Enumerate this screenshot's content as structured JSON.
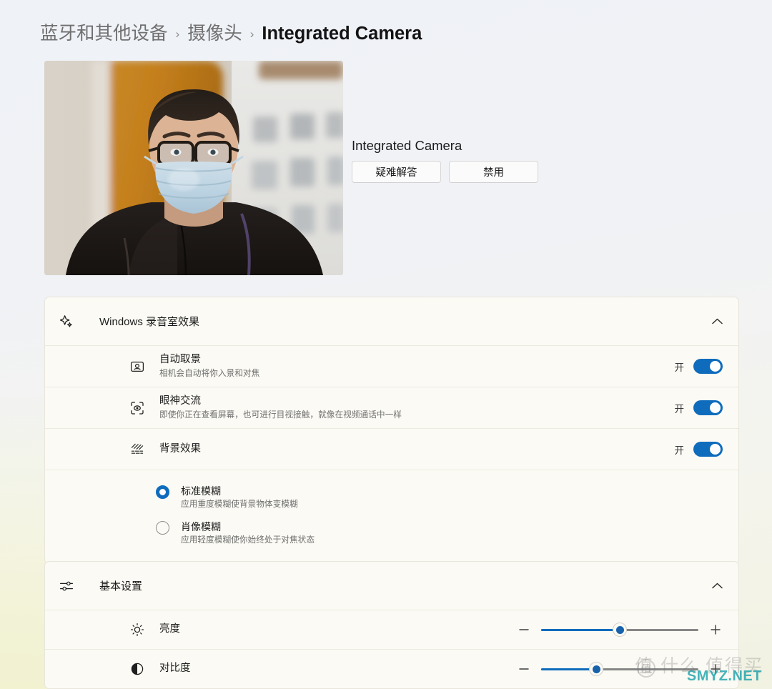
{
  "breadcrumb": {
    "items": [
      {
        "label": "蓝牙和其他设备",
        "current": false
      },
      {
        "label": "摄像头",
        "current": false
      },
      {
        "label": "Integrated Camera",
        "current": true
      }
    ],
    "separator": "›"
  },
  "preview": {
    "alt_name": "camera-preview"
  },
  "device": {
    "name": "Integrated Camera",
    "troubleshoot_label": "疑难解答",
    "disable_label": "禁用"
  },
  "studio": {
    "title": "Windows 录音室效果",
    "icon": "sparkle-icon",
    "collapse_icon": "chevron-up-icon",
    "rows": [
      {
        "icon": "auto-framing-icon",
        "title": "自动取景",
        "subtitle": "相机会自动将你入景和对焦",
        "toggle_label": "开",
        "toggle_on": true
      },
      {
        "icon": "eye-contact-icon",
        "title": "眼神交流",
        "subtitle": "即使你正在查看屏幕，也可进行目视接触，就像在视频通话中一样",
        "toggle_label": "开",
        "toggle_on": true
      },
      {
        "icon": "background-effects-icon",
        "title": "背景效果",
        "subtitle": "",
        "toggle_label": "开",
        "toggle_on": true
      }
    ],
    "blur_options": [
      {
        "title": "标准模糊",
        "subtitle": "应用重度模糊使背景物体变模糊",
        "selected": true
      },
      {
        "title": "肖像模糊",
        "subtitle": "应用轻度模糊使你始终处于对焦状态",
        "selected": false
      }
    ]
  },
  "basic": {
    "title": "基本设置",
    "icon": "sliders-icon",
    "collapse_icon": "chevron-up-icon",
    "sliders": [
      {
        "icon": "brightness-icon",
        "title": "亮度",
        "value_percent": 50,
        "minus_label": "−",
        "plus_label": "+"
      },
      {
        "icon": "contrast-icon",
        "title": "对比度",
        "value_percent": 35,
        "minus_label": "−",
        "plus_label": "+"
      }
    ]
  },
  "watermark": {
    "cn": "值 什么 值得买",
    "en": "SMYZ.NET",
    "badge": "值"
  },
  "colors": {
    "accent": "#0f6cbd",
    "page_bg": "#eff2f7",
    "card_bg": "#fbfaf4",
    "watermark_teal": "#16a0aa"
  }
}
